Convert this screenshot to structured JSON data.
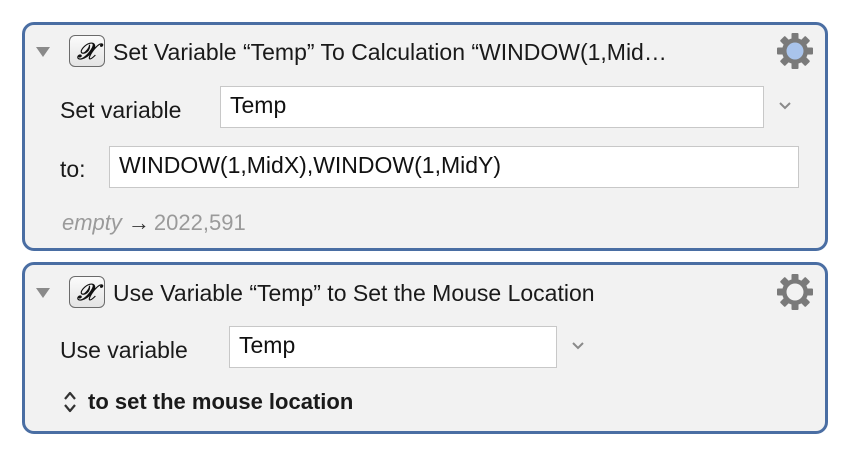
{
  "actions": [
    {
      "title": "Set Variable “Temp” To Calculation “WINDOW(1,Mid…",
      "icon": "calculator-x-icon",
      "variable_label": "Set variable",
      "variable_value": "Temp",
      "to_label": "to:",
      "calculation": "WINDOW(1,MidX),WINDOW(1,MidY)",
      "result_prefix": "empty",
      "result_arrow": "→",
      "result_value": "2022,591"
    },
    {
      "title": "Use Variable “Temp” to Set the Mouse Location",
      "icon": "calculator-x-icon",
      "variable_label": "Use variable",
      "variable_value": "Temp",
      "option_label": "to set the mouse location"
    }
  ],
  "colors": {
    "border_accent": "#4a6ea3",
    "panel_background": "#f2f2f2",
    "gear_highlight": "#a9c4ec"
  }
}
